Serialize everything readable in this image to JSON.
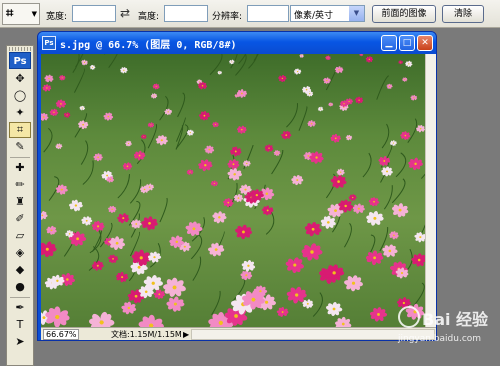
{
  "options_bar": {
    "tool_icon": "crop-icon",
    "width_label": "宽度:",
    "width_value": "",
    "swap_icon": "swap-arrows-icon",
    "height_label": "高度:",
    "height_value": "",
    "resolution_label": "分辨率:",
    "resolution_value": "",
    "unit_selected": "像素/英寸",
    "front_image_button": "前面的图像",
    "clear_button": "清除"
  },
  "toolbox": {
    "logo": "Ps",
    "tools": [
      {
        "name": "move-tool-icon",
        "glyph": "✥"
      },
      {
        "name": "lasso-tool-icon",
        "glyph": "◯"
      },
      {
        "name": "magic-wand-tool-icon",
        "glyph": "✦"
      },
      {
        "name": "crop-tool-icon",
        "glyph": "⌗"
      },
      {
        "name": "eyedropper-tool-icon",
        "glyph": "✎"
      },
      {
        "name": "healing-brush-tool-icon",
        "glyph": "✚"
      },
      {
        "name": "brush-tool-icon",
        "glyph": "✏"
      },
      {
        "name": "clone-stamp-tool-icon",
        "glyph": "♜"
      },
      {
        "name": "history-brush-tool-icon",
        "glyph": "✐"
      },
      {
        "name": "eraser-tool-icon",
        "glyph": "▱"
      },
      {
        "name": "paint-bucket-tool-icon",
        "glyph": "◈"
      },
      {
        "name": "blur-tool-icon",
        "glyph": "◆"
      },
      {
        "name": "dodge-tool-icon",
        "glyph": "●"
      },
      {
        "name": "pen-tool-icon",
        "glyph": "✒"
      },
      {
        "name": "type-tool-icon",
        "glyph": "T"
      },
      {
        "name": "path-selection-tool-icon",
        "glyph": "➤"
      }
    ],
    "active_index": 3
  },
  "document": {
    "title": "s.jpg @ 66.7% (图层 0, RGB/8#)",
    "minimize_glyph": "▁",
    "maximize_glyph": "□",
    "close_glyph": "✕",
    "zoom": "66.67%",
    "doc_info": "文档:1.15M/1.15M",
    "status_arrow": "▶"
  },
  "watermark": {
    "brand": "Bai 经验",
    "url": "jingyan.baidu.com"
  },
  "colors": {
    "title_bar": "#0a4fd6",
    "flower_magenta": "#e6338c",
    "flower_pink": "#f28ac4",
    "flower_white": "#f4e6f0"
  }
}
